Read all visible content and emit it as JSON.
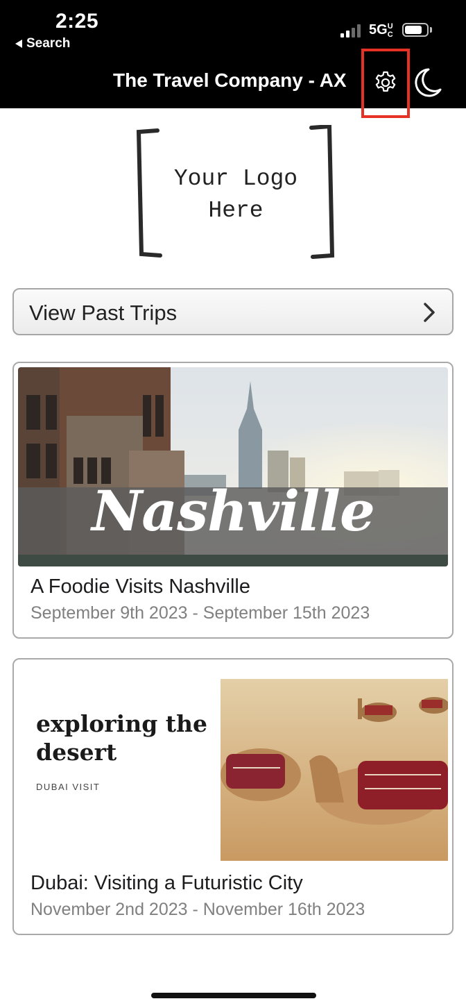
{
  "status_bar": {
    "time": "2:25",
    "back_label": "Search",
    "network": "5G",
    "network_suffix": "UC"
  },
  "nav": {
    "title": "The Travel Company - AX",
    "settings_icon": "gear-icon",
    "theme_icon": "moon-icon",
    "highlight_color": "#e53224"
  },
  "logo": {
    "line1": "Your Logo",
    "line2": "Here"
  },
  "past_trips": {
    "label": "View Past Trips"
  },
  "trips": [
    {
      "image_text": "Nashville",
      "title": "A Foodie Visits Nashville",
      "dates": "September 9th 2023 - September 15th 2023"
    },
    {
      "image_heading": "exploring the desert",
      "image_subheading": "DUBAI VISIT",
      "title": "Dubai: Visiting a Futuristic City",
      "dates": "November 2nd 2023 - November 16th 2023"
    }
  ]
}
